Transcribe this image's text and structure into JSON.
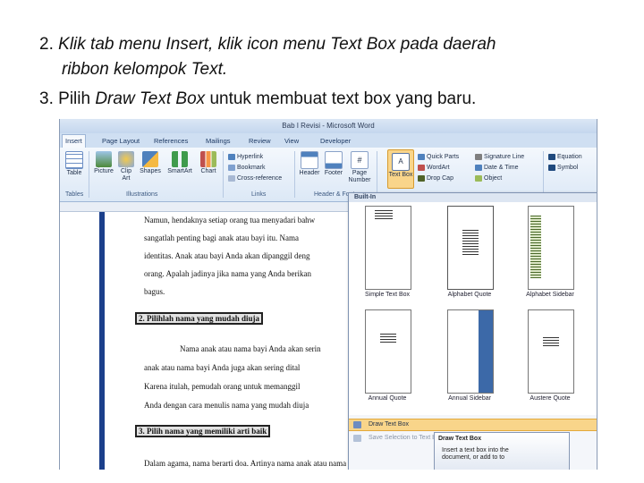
{
  "slide": {
    "step2_num": "2.",
    "step2_text": "Klik tab menu Insert, klik icon menu Text Box pada daerah",
    "step2_cont": "ribbon kelompok Text.",
    "step3_num": "3.",
    "step3_pre": "Pilih",
    "step3_em": "Draw Text Box",
    "step3_post": "untuk membuat text box yang baru."
  },
  "window": {
    "title": "Bab I Revisi - Microsoft Word"
  },
  "tabs": [
    "Insert",
    "Page Layout",
    "References",
    "Mailings",
    "Review",
    "View",
    "Developer"
  ],
  "ribbon": {
    "tables": {
      "button": "Table",
      "group": "Tables"
    },
    "illustrations": {
      "buttons": [
        "Picture",
        "Clip Art",
        "Shapes",
        "SmartArt",
        "Chart"
      ],
      "group": "Illustrations"
    },
    "links": {
      "items": [
        "Hyperlink",
        "Bookmark",
        "Cross-reference"
      ],
      "group": "Links"
    },
    "header_footer": {
      "buttons": [
        "Header",
        "Footer",
        "Page Number"
      ],
      "group": "Header & Footer"
    },
    "text": {
      "text_box": "Text Box",
      "items_col1": [
        "Quick Parts",
        "WordArt",
        "Drop Cap"
      ],
      "items_col2": [
        "Signature Line",
        "Date & Time",
        "Object"
      ]
    },
    "symbols": {
      "items": [
        "Equation",
        "Symbol"
      ]
    }
  },
  "document": {
    "lines1": [
      "Namun, hendaknya setiap orang tua menyadari bahw",
      "sangatlah penting bagi anak atau bayi itu. Nama",
      "identitas. Anak atau bayi Anda akan dipanggil deng",
      "orang. Apalah jadinya jika nama yang Anda berikan",
      "bagus."
    ],
    "heading1": "2. Pilihlah nama yang mudah diuja",
    "lines2": [
      "Nama anak atau nama bayi Anda akan serin",
      "anak atau nama bayi Anda juga akan sering dital",
      "Karena itulah, pemudah orang untuk memanggil",
      "Anda dengan cara menulis nama yang mudah diuja"
    ],
    "heading2": "3. Pilih nama yang memiliki arti baik",
    "line3": "Dalam agama, nama berarti doa. Artinya nama anak atau nama bayi adalah"
  },
  "gallery": {
    "section": "Built-In",
    "thumbs": [
      "Simple Text Box",
      "Alphabet Quote",
      "Alphabet Sidebar",
      "Annual Quote",
      "Annual Sidebar",
      "Austere Quote"
    ],
    "menu": [
      "Draw Text Box",
      "Save Selection to Text Box Gallery"
    ]
  },
  "tooltip": {
    "title": "Draw Text Box",
    "body1": "Insert a text box into the",
    "body2": "document, or add to to"
  },
  "colors": {
    "accent": "#1b3f8b",
    "ribbon": "#dce8f6",
    "highlight": "#f9d58a"
  }
}
